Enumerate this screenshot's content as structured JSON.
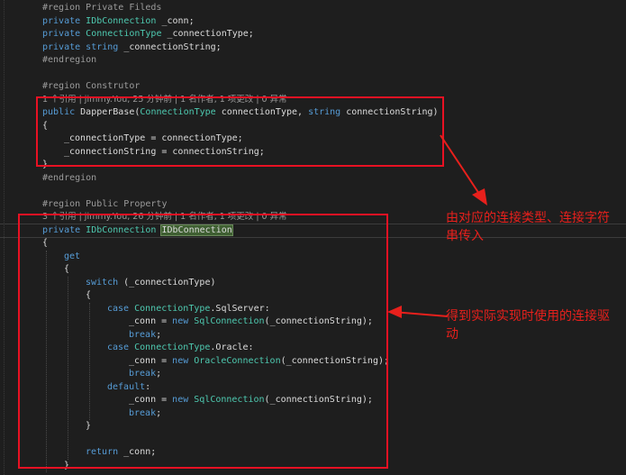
{
  "code": {
    "lines": [
      {
        "indent": 0,
        "tokens": [
          {
            "t": "#region Private Fileds",
            "c": "region"
          }
        ]
      },
      {
        "indent": 0,
        "tokens": [
          {
            "t": "private ",
            "c": "kw"
          },
          {
            "t": "IDbConnection",
            "c": "type"
          },
          {
            "t": " _conn;",
            "c": "plain"
          }
        ]
      },
      {
        "indent": 0,
        "tokens": [
          {
            "t": "private ",
            "c": "kw"
          },
          {
            "t": "ConnectionType",
            "c": "type"
          },
          {
            "t": " _connectionType;",
            "c": "plain"
          }
        ]
      },
      {
        "indent": 0,
        "tokens": [
          {
            "t": "private ",
            "c": "kw"
          },
          {
            "t": "string",
            "c": "kw"
          },
          {
            "t": " _connectionString;",
            "c": "plain"
          }
        ]
      },
      {
        "indent": 0,
        "tokens": [
          {
            "t": "#endregion",
            "c": "region"
          }
        ]
      },
      {
        "indent": 0,
        "tokens": []
      },
      {
        "indent": 0,
        "tokens": [
          {
            "t": "#region Construtor",
            "c": "region"
          }
        ]
      },
      {
        "indent": 0,
        "tokens": [
          {
            "t": "1 个引用 | jimmy.You, 25 分钟前 | 1 名作者, 1 项更改 | 0 异常",
            "c": "lens"
          }
        ]
      },
      {
        "indent": 0,
        "tokens": [
          {
            "t": "public ",
            "c": "kw"
          },
          {
            "t": "DapperBase",
            "c": "plain"
          },
          {
            "t": "(",
            "c": "plain"
          },
          {
            "t": "ConnectionType",
            "c": "type"
          },
          {
            "t": " connectionType, ",
            "c": "plain"
          },
          {
            "t": "string",
            "c": "kw"
          },
          {
            "t": " connectionString)",
            "c": "plain"
          }
        ]
      },
      {
        "indent": 0,
        "tokens": [
          {
            "t": "{",
            "c": "plain"
          }
        ]
      },
      {
        "indent": 1,
        "tokens": [
          {
            "t": "_connectionType = connectionType;",
            "c": "plain"
          }
        ]
      },
      {
        "indent": 1,
        "tokens": [
          {
            "t": "_connectionString = connectionString;",
            "c": "plain"
          }
        ]
      },
      {
        "indent": 0,
        "tokens": [
          {
            "t": "}",
            "c": "plain"
          }
        ]
      },
      {
        "indent": 0,
        "tokens": [
          {
            "t": "#endregion",
            "c": "region"
          }
        ]
      },
      {
        "indent": 0,
        "tokens": []
      },
      {
        "indent": 0,
        "tokens": [
          {
            "t": "#region Public Property",
            "c": "region"
          }
        ]
      },
      {
        "indent": 0,
        "tokens": [
          {
            "t": "3 个引用 | jimmy.You, 26 分钟前 | 1 名作者, 1 项更改 | 0 异常",
            "c": "lens"
          }
        ]
      },
      {
        "indent": 0,
        "tokens": [
          {
            "t": "private ",
            "c": "kw"
          },
          {
            "t": "IDbConnection",
            "c": "type"
          },
          {
            "t": " ",
            "c": "plain"
          },
          {
            "t": "IDbConnection",
            "c": "hl"
          }
        ]
      },
      {
        "indent": 0,
        "tokens": [
          {
            "t": "{",
            "c": "plain"
          }
        ]
      },
      {
        "indent": 1,
        "tokens": [
          {
            "t": "get",
            "c": "kw"
          }
        ]
      },
      {
        "indent": 1,
        "tokens": [
          {
            "t": "{",
            "c": "plain"
          }
        ]
      },
      {
        "indent": 2,
        "tokens": [
          {
            "t": "switch",
            "c": "kw"
          },
          {
            "t": " (_connectionType)",
            "c": "plain"
          }
        ]
      },
      {
        "indent": 2,
        "tokens": [
          {
            "t": "{",
            "c": "plain"
          }
        ]
      },
      {
        "indent": 3,
        "tokens": [
          {
            "t": "case ",
            "c": "kw"
          },
          {
            "t": "ConnectionType",
            "c": "type"
          },
          {
            "t": ".SqlServer:",
            "c": "plain"
          }
        ]
      },
      {
        "indent": 4,
        "tokens": [
          {
            "t": "_conn = ",
            "c": "plain"
          },
          {
            "t": "new ",
            "c": "kw"
          },
          {
            "t": "SqlConnection",
            "c": "type"
          },
          {
            "t": "(_connectionString);",
            "c": "plain"
          }
        ]
      },
      {
        "indent": 4,
        "tokens": [
          {
            "t": "break",
            "c": "kw"
          },
          {
            "t": ";",
            "c": "plain"
          }
        ]
      },
      {
        "indent": 3,
        "tokens": [
          {
            "t": "case ",
            "c": "kw"
          },
          {
            "t": "ConnectionType",
            "c": "type"
          },
          {
            "t": ".Oracle:",
            "c": "plain"
          }
        ]
      },
      {
        "indent": 4,
        "tokens": [
          {
            "t": "_conn = ",
            "c": "plain"
          },
          {
            "t": "new ",
            "c": "kw"
          },
          {
            "t": "OracleConnection",
            "c": "type"
          },
          {
            "t": "(_connectionString);",
            "c": "plain"
          }
        ]
      },
      {
        "indent": 4,
        "tokens": [
          {
            "t": "break",
            "c": "kw"
          },
          {
            "t": ";",
            "c": "plain"
          }
        ]
      },
      {
        "indent": 3,
        "tokens": [
          {
            "t": "default",
            "c": "kw"
          },
          {
            "t": ":",
            "c": "plain"
          }
        ]
      },
      {
        "indent": 4,
        "tokens": [
          {
            "t": "_conn = ",
            "c": "plain"
          },
          {
            "t": "new ",
            "c": "kw"
          },
          {
            "t": "SqlConnection",
            "c": "type"
          },
          {
            "t": "(_connectionString);",
            "c": "plain"
          }
        ]
      },
      {
        "indent": 4,
        "tokens": [
          {
            "t": "break",
            "c": "kw"
          },
          {
            "t": ";",
            "c": "plain"
          }
        ]
      },
      {
        "indent": 2,
        "tokens": [
          {
            "t": "}",
            "c": "plain"
          }
        ]
      },
      {
        "indent": 0,
        "tokens": []
      },
      {
        "indent": 2,
        "tokens": [
          {
            "t": "return",
            "c": "kw"
          },
          {
            "t": " _conn;",
            "c": "plain"
          }
        ]
      },
      {
        "indent": 1,
        "tokens": [
          {
            "t": "}",
            "c": "plain"
          }
        ]
      }
    ]
  },
  "annotations": {
    "constructor_note": "由对应的连接类型、连接字符串传入",
    "switch_note": "得到实际实现时使用的连接驱动"
  },
  "colors": {
    "background": "#1e1e1e",
    "keyword": "#569cd6",
    "type": "#4ec9b0",
    "region": "#9b9b9b",
    "annotation_red": "#e8201c"
  }
}
